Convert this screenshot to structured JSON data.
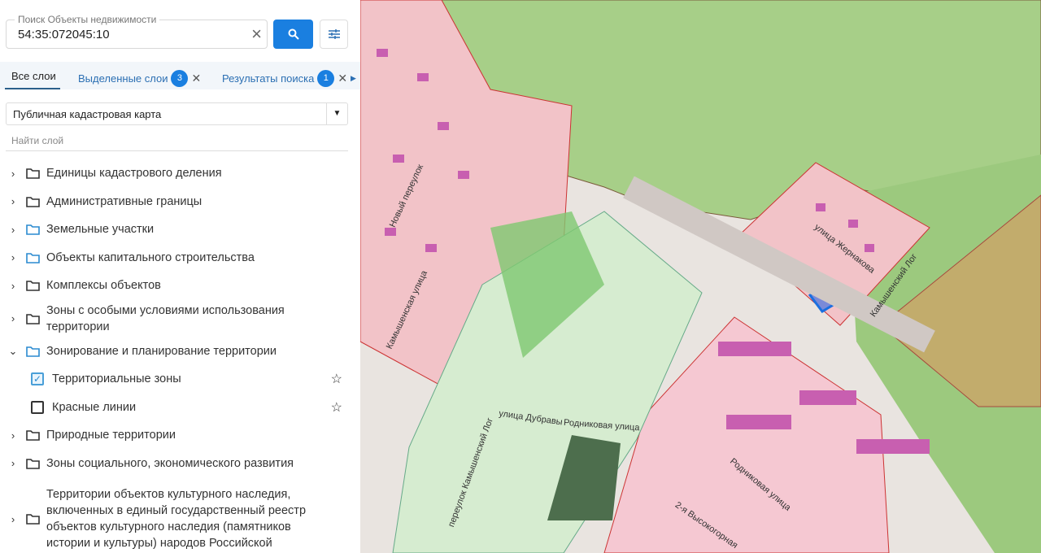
{
  "search": {
    "label": "Поиск Объекты недвижимости",
    "value": "54:35:072045:10"
  },
  "tabs": [
    {
      "label": "Все слои"
    },
    {
      "label": "Выделенные слои",
      "count": "3"
    },
    {
      "label": "Результаты поиска",
      "count": "1"
    }
  ],
  "basemap": {
    "selected": "Публичная кадастровая карта"
  },
  "layer_search": {
    "placeholder": "Найти слой"
  },
  "tree": [
    {
      "label": "Единицы кадастрового деления"
    },
    {
      "label": "Административные границы"
    },
    {
      "label": "Земельные участки"
    },
    {
      "label": "Объекты капитального строительства"
    },
    {
      "label": "Комплексы объектов"
    },
    {
      "label": "Зоны с особыми условиями использования территории"
    },
    {
      "label": "Зонирование и планирование территории"
    },
    {
      "label": "Территориальные зоны",
      "checked": true
    },
    {
      "label": "Красные линии",
      "checked": false
    },
    {
      "label": "Природные территории"
    },
    {
      "label": "Зоны социального, экономического развития"
    },
    {
      "label": "Территории объектов культурного наследия, включенных в единый государственный реестр объектов культурного наследия (памятников истории и культуры) народов Российской"
    }
  ],
  "map": {
    "streets": [
      "улица Жернакова",
      "Камышенский Лог",
      "улица Дубравы",
      "Родниковая улица",
      "Новый переулок",
      "Камышенская улица",
      "переулок Камышенский Лог",
      "Родниковая улица",
      "2-я Высокогорная"
    ]
  },
  "colors": {
    "accent": "#1a7fe0",
    "forest": "#9cc97e",
    "residential": "#f2c3c8",
    "building": "#c85fb0"
  }
}
